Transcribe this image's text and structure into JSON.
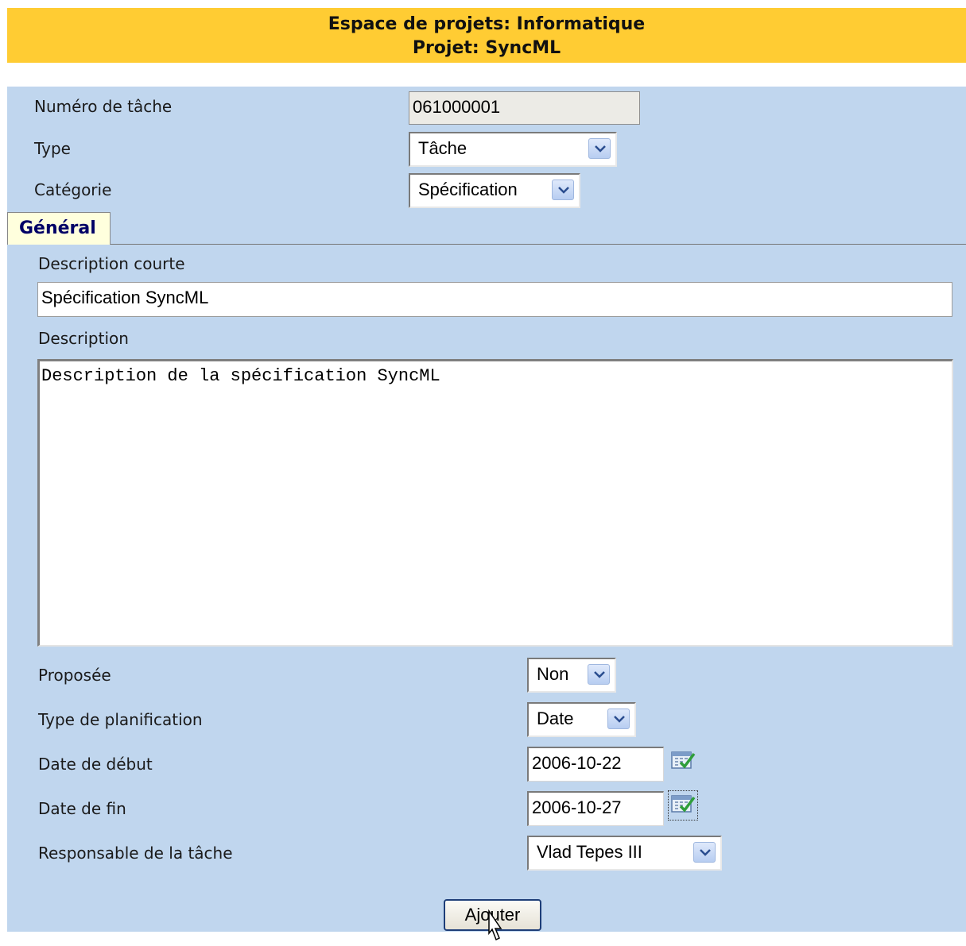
{
  "header": {
    "line1": "Espace de projets: Informatique",
    "line2": "Projet: SyncML"
  },
  "top_fields": {
    "task_number_label": "Numéro de tâche",
    "task_number_value": "061000001",
    "type_label": "Type",
    "type_value": "Tâche",
    "category_label": "Catégorie",
    "category_value": "Spécification"
  },
  "tab": {
    "general_label": "Général"
  },
  "form": {
    "short_desc_label": "Description courte",
    "short_desc_value": "Spécification SyncML",
    "desc_label": "Description",
    "desc_value": "Description de la spécification SyncML",
    "proposed_label": "Proposée",
    "proposed_value": "Non",
    "planning_type_label": "Type de planification",
    "planning_type_value": "Date",
    "start_date_label": "Date de début",
    "start_date_value": "2006-10-22",
    "end_date_label": "Date de fin",
    "end_date_value": "2006-10-27",
    "owner_label": "Responsable de la tâche",
    "owner_value": "Vlad Tepes III"
  },
  "actions": {
    "add_label": "Ajouter"
  },
  "colors": {
    "header_bg": "#ffcc33",
    "panel_bg": "#c0d6ee",
    "tab_bg": "#ffffdd",
    "tab_text": "#000066"
  },
  "icons": [
    "chevron-down-icon",
    "calendar-icon",
    "mouse-pointer-icon"
  ]
}
